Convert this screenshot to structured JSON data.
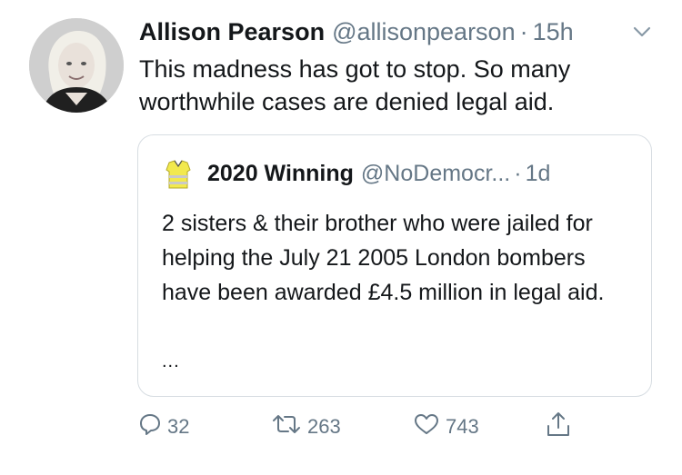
{
  "tweet": {
    "author_name": "Allison Pearson",
    "author_handle": "@allisonpearson",
    "separator": "·",
    "time": "15h",
    "text": "This madness has got to stop. So many worthwhile cases are denied legal aid."
  },
  "quoted_tweet": {
    "author_name": "2020 Winning",
    "author_handle": "@NoDemocr...",
    "separator": "·",
    "time": "1d",
    "text": "2 sisters & their brother who were jailed for helping the July 21 2005 London bombers have been awarded £4.5 million in legal aid.",
    "more": "..."
  },
  "actions": {
    "reply_count": "32",
    "retweet_count": "263",
    "like_count": "743"
  },
  "colors": {
    "text": "#14171a",
    "secondary": "#657786",
    "border": "#d7dde2"
  },
  "icons": [
    "chevron-down-icon",
    "reply-icon",
    "retweet-icon",
    "like-icon",
    "share-icon"
  ]
}
